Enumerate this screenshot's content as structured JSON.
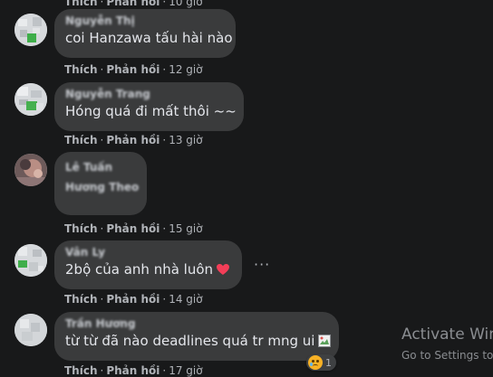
{
  "top_partial": {
    "action_like": "Thích",
    "action_reply": "Phản hồi",
    "time": "10 giờ"
  },
  "comments": [
    {
      "name": "Nguyễn Thị",
      "text": "coi Hanzawa tấu hài nào",
      "like": "Thích",
      "reply": "Phản hồi",
      "time": "12 giờ"
    },
    {
      "name": "Nguyễn Trang",
      "text": "Hóng quá đi mất thôi ~~",
      "like": "Thích",
      "reply": "Phản hồi",
      "time": "13 giờ"
    },
    {
      "name": "Lê Tuấn",
      "text": "Hương Theo",
      "like": "Thích",
      "reply": "Phản hồi",
      "time": "15 giờ"
    },
    {
      "name": "Vân Ly",
      "text": "2bộ của anh nhà luôn",
      "like": "Thích",
      "reply": "Phản hồi",
      "time": "14 giờ"
    },
    {
      "name": "Trần Hương",
      "text": "từ từ đã nào deadlines quá tr mng ui",
      "like": "Thích",
      "reply": "Phản hồi",
      "time": "17 giờ",
      "reaction_count": "1",
      "reaction_icon": "sad-face-icon"
    }
  ],
  "more_options": "···",
  "watermark": {
    "title": "Activate Windows",
    "subtitle": "Go to Settings to activate Windows."
  },
  "colors": {
    "background": "#18191a",
    "bubble": "#3a3b3c",
    "text_primary": "#e4e6eb",
    "text_secondary": "#b0b3b8",
    "heart": "#f33e58"
  }
}
